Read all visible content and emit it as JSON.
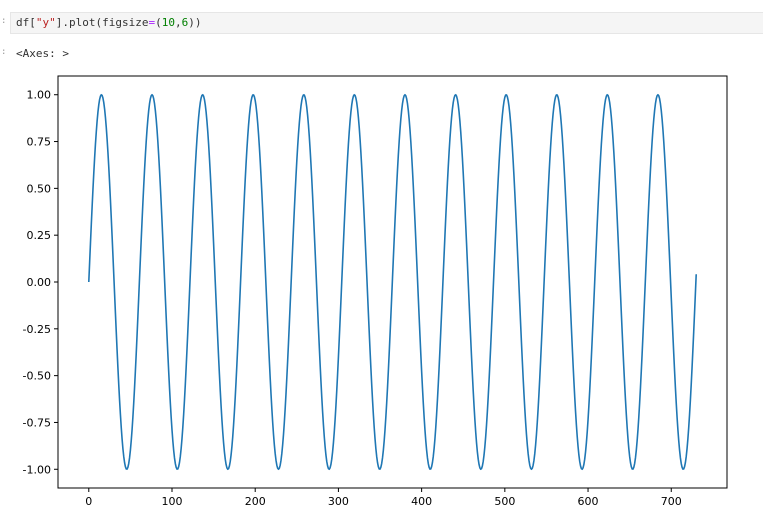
{
  "cell": {
    "gutter_marks": [
      ":",
      ":"
    ],
    "code_tokens": [
      {
        "text": "df[",
        "style": "plain"
      },
      {
        "text": "\"y\"",
        "style": "string"
      },
      {
        "text": "].plot(figsize",
        "style": "plain"
      },
      {
        "text": "=",
        "style": "op"
      },
      {
        "text": "(",
        "style": "plain"
      },
      {
        "text": "10",
        "style": "number"
      },
      {
        "text": ",",
        "style": "plain"
      },
      {
        "text": "6",
        "style": "number"
      },
      {
        "text": "))",
        "style": "plain"
      }
    ],
    "output_repr": "<Axes: >"
  },
  "colors": {
    "line": "#1f77b4",
    "code_string": "#ba2121",
    "code_number": "#008000",
    "code_operator": "#aa22ff",
    "code_background": "#f5f5f5"
  },
  "chart_data": {
    "type": "line",
    "title": "",
    "xlabel": "",
    "ylabel": "",
    "xlim": [
      -37,
      767
    ],
    "ylim": [
      -1.1,
      1.1
    ],
    "xticks": [
      0,
      100,
      200,
      300,
      400,
      500,
      600,
      700
    ],
    "yticks": [
      1.0,
      0.75,
      0.5,
      0.25,
      0.0,
      -0.25,
      -0.5,
      -0.75,
      -1.0
    ],
    "ytick_labels": [
      "1.00",
      "0.75",
      "0.50",
      "0.25",
      "0.00",
      "-0.25",
      "-0.50",
      "-0.75",
      "-1.00"
    ],
    "grid": false,
    "legend": "none",
    "series": [
      {
        "x_start": 0,
        "x_end": 730,
        "x_step": 1,
        "y_function": "sin(2*pi*x/60.8)",
        "period": 60.8,
        "amplitude": 1.0,
        "first_value": 0.0,
        "last_value": 0.0
      }
    ]
  }
}
